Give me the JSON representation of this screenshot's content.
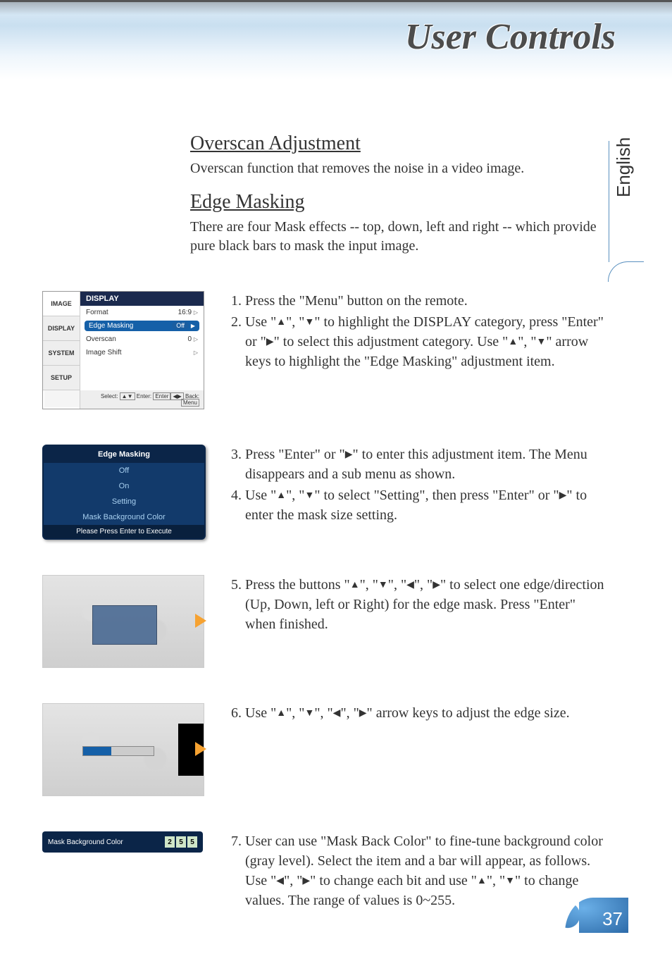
{
  "header": {
    "title": "User Controls"
  },
  "language_tab": "English",
  "sections": {
    "overscan": {
      "heading": "Overscan Adjustment",
      "desc": "Overscan function that removes the noise in a video image."
    },
    "edgemask": {
      "heading": "Edge Masking",
      "desc": "There are four Mask effects -- top, down, left and right -- which provide pure black bars to mask the input image."
    }
  },
  "osd1": {
    "tabs": [
      "IMAGE",
      "DISPLAY",
      "SYSTEM",
      "SETUP"
    ],
    "title": "DISPLAY",
    "rows": [
      {
        "label": "Format",
        "value": "16:9"
      },
      {
        "label": "Edge Masking",
        "value": "Off",
        "highlight": true
      },
      {
        "label": "Overscan",
        "value": "0"
      },
      {
        "label": "Image Shift",
        "value": ""
      }
    ],
    "hint_select": "Select:",
    "hint_enter": "Enter:",
    "hint_enter_btn": "Enter",
    "hint_back": "Back:",
    "hint_back_btn": "Menu"
  },
  "osd2": {
    "title": "Edge Masking",
    "items": [
      "Off",
      "On",
      "Setting",
      "Mask Background Color"
    ],
    "bottom": "Please Press Enter to Execute"
  },
  "maskbar": {
    "label": "Mask Background Color",
    "digits": [
      "2",
      "5",
      "5"
    ]
  },
  "steps": {
    "s1": "Press the \"Menu\" button on the remote.",
    "s2a": "Use \"",
    "s2b": "\", \"",
    "s2c": "\" to highlight the DISPLAY category, press \"Enter\" or \"",
    "s2d": "\" to select this adjustment category. Use \"",
    "s2e": "\", \"",
    "s2f": "\" arrow keys to highlight the \"Edge Masking\" adjustment item.",
    "s3a": "Press \"Enter\" or \"",
    "s3b": "\" to enter this adjustment item. The Menu disappears and a sub menu as shown.",
    "s4a": "Use \"",
    "s4b": "\", \"",
    "s4c": "\" to select \"Setting\", then press \"Enter\" or \"",
    "s4d": "\" to enter the mask size setting.",
    "s5a": "Press the buttons \"",
    "s5b": "\", \"",
    "s5c": "\", \"",
    "s5d": "\", \"",
    "s5e": "\" to select one edge/direction (Up, Down, left or Right) for the edge mask. Press \"Enter\" when finished.",
    "s6a": "Use \"",
    "s6b": "\", \"",
    "s6c": "\", \"",
    "s6d": "\", \"",
    "s6e": "\" arrow keys to adjust the edge size.",
    "s7a": "User can use \"Mask Back Color\" to fine-tune background color (gray level). Select the item and a bar will appear, as follows. Use \"",
    "s7b": "\", \"",
    "s7c": "\" to change each bit and use \"",
    "s7d": "\", \"",
    "s7e": "\" to change values. The range of values is 0~255."
  },
  "page_number": "37"
}
